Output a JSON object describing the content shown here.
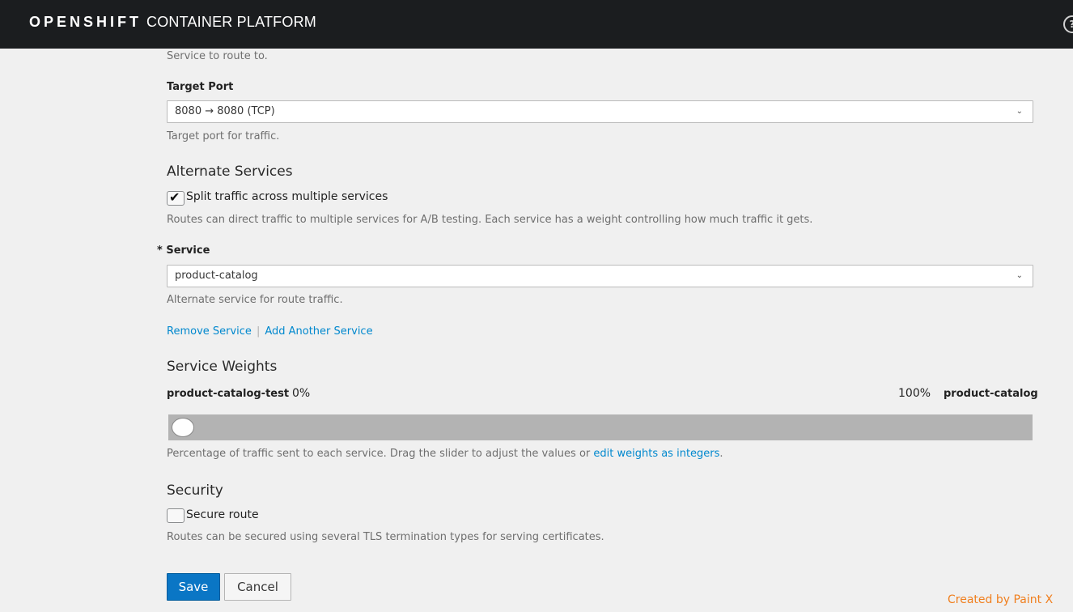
{
  "header": {
    "brand_bold": "OPENSHIFT",
    "brand_rest": "CONTAINER PLATFORM"
  },
  "service_help": "Service to route to.",
  "target_port": {
    "label": "Target Port",
    "value": "8080 → 8080 (TCP)",
    "help": "Target port for traffic."
  },
  "alternate_services": {
    "title": "Alternate Services",
    "split_label": "Split traffic across multiple services",
    "split_checked": true,
    "help": "Routes can direct traffic to multiple services for A/B testing. Each service has a weight controlling how much traffic it gets."
  },
  "alt_service": {
    "required_marker": "*",
    "label": "Service",
    "value": "product-catalog",
    "help": "Alternate service for route traffic."
  },
  "service_links": {
    "remove": "Remove Service",
    "separator": "|",
    "add": "Add Another Service"
  },
  "service_weights": {
    "title": "Service Weights",
    "left_name": "product-catalog-test",
    "left_value": "0%",
    "right_value": "100%",
    "right_name": "product-catalog",
    "slider_fraction": 0,
    "help_prefix": "Percentage of traffic sent to each service. Drag the slider to adjust the values or ",
    "help_link": "edit weights as integers",
    "help_suffix": "."
  },
  "security": {
    "title": "Security",
    "secure_label": "Secure route",
    "secure_checked": false,
    "help": "Routes can be secured using several TLS termination types for serving certificates."
  },
  "actions": {
    "save": "Save",
    "cancel": "Cancel"
  },
  "watermark": "Created by Paint X"
}
